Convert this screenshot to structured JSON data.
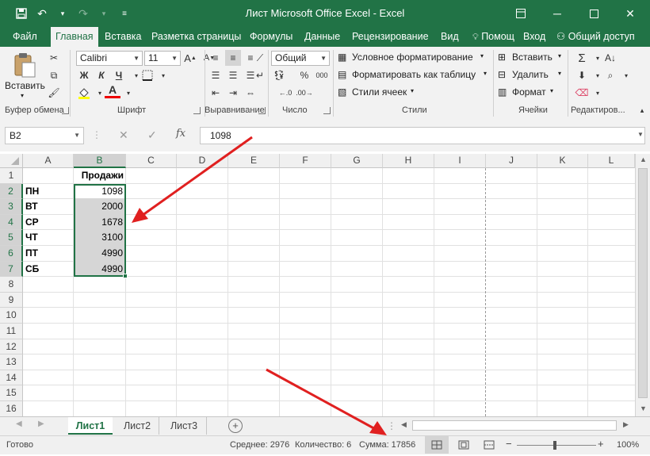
{
  "window": {
    "title": "Лист Microsoft Office Excel - Excel"
  },
  "ribbon_tabs": [
    {
      "label": "Файл"
    },
    {
      "label": "Главная"
    },
    {
      "label": "Вставка"
    },
    {
      "label": "Разметка страницы"
    },
    {
      "label": "Формулы"
    },
    {
      "label": "Данные"
    },
    {
      "label": "Рецензирование"
    },
    {
      "label": "Вид"
    },
    {
      "label": "Помощ"
    },
    {
      "label": "Вход"
    },
    {
      "label": "Общий доступ"
    }
  ],
  "ribbon": {
    "paste_label": "Вставить",
    "font_name": "Calibri",
    "font_size": "11",
    "bold": "Ж",
    "italic": "К",
    "underline": "Ч",
    "number_format": "Общий",
    "percent": "%",
    "thousands": "000",
    "cond_format": "Условное форматирование",
    "format_table": "Форматировать как таблицу",
    "cell_styles": "Стили ячеек",
    "insert": "Вставить",
    "delete": "Удалить",
    "format": "Формат",
    "groups": {
      "clipboard": "Буфер обмена",
      "font": "Шрифт",
      "alignment": "Выравнивание",
      "number": "Число",
      "styles": "Стили",
      "cells": "Ячейки",
      "editing": "Редактиров..."
    }
  },
  "formula_bar": {
    "name_box": "B2",
    "fx": "fx",
    "value": "1098"
  },
  "grid": {
    "columns": [
      "A",
      "B",
      "C",
      "D",
      "E",
      "F",
      "G",
      "H",
      "I",
      "J",
      "K",
      "L"
    ],
    "rows": [
      "1",
      "2",
      "3",
      "4",
      "5",
      "6",
      "7",
      "8",
      "9",
      "10",
      "11",
      "12",
      "13",
      "14",
      "15",
      "16"
    ],
    "header_b1": "Продажи",
    "data": [
      {
        "day": "ПН",
        "value": "1098"
      },
      {
        "day": "ВТ",
        "value": "2000"
      },
      {
        "day": "СР",
        "value": "1678"
      },
      {
        "day": "ЧТ",
        "value": "3100"
      },
      {
        "day": "ПТ",
        "value": "4990"
      },
      {
        "day": "СБ",
        "value": "4990"
      }
    ]
  },
  "sheets": [
    {
      "label": "Лист1",
      "active": true
    },
    {
      "label": "Лист2",
      "active": false
    },
    {
      "label": "Лист3",
      "active": false
    }
  ],
  "status": {
    "ready": "Готово",
    "average": "Среднее: 2976",
    "count": "Количество: 6",
    "sum": "Сумма: 17856",
    "zoom": "100%"
  },
  "colors": {
    "excel_green": "#217346",
    "arrow_red": "#e02020"
  }
}
